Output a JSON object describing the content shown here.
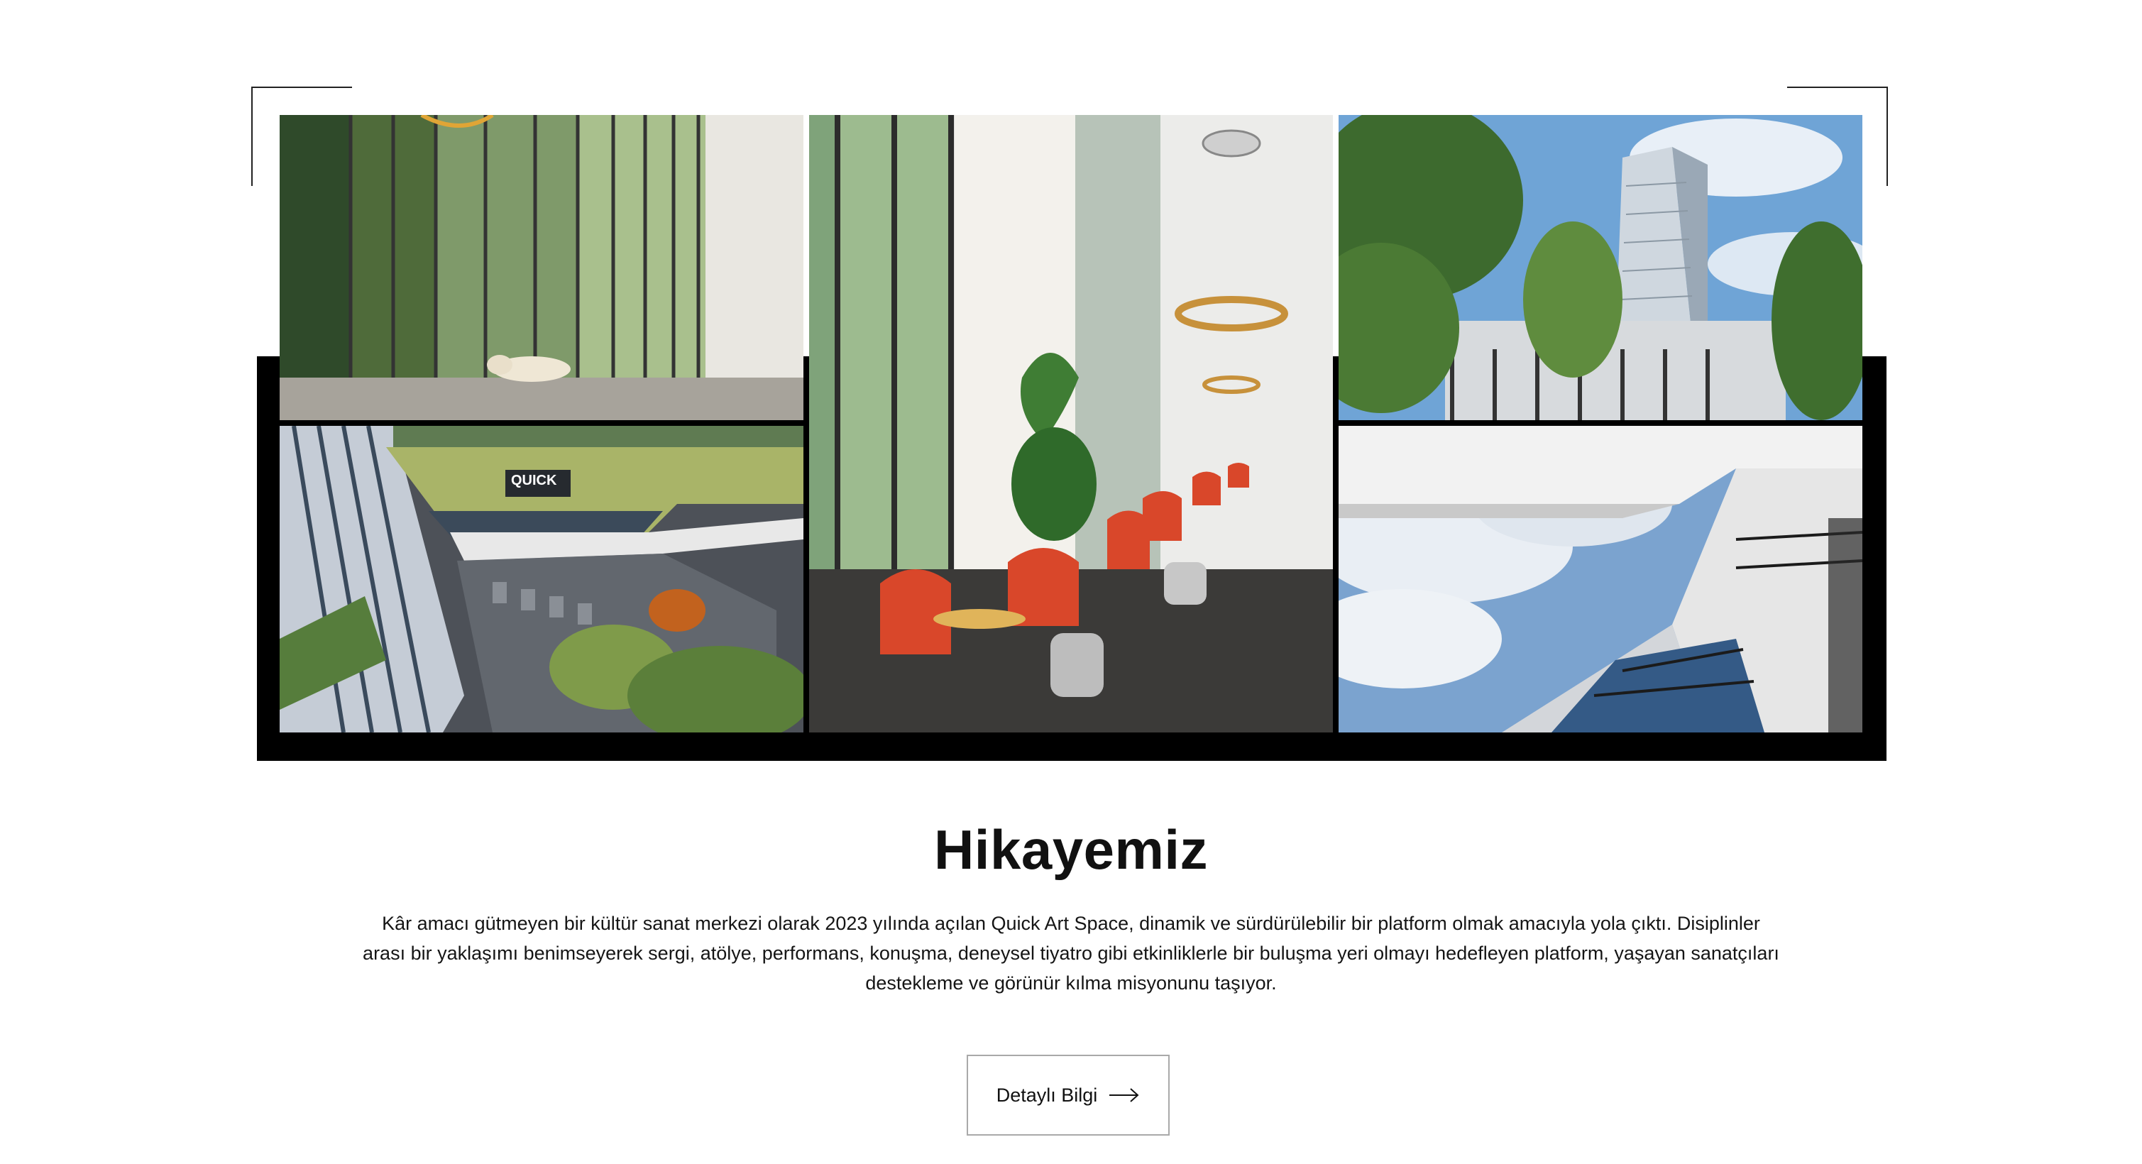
{
  "gallery": {
    "tiles": [
      {
        "name": "tower-facade-dog"
      },
      {
        "name": "lounge-red-chairs"
      },
      {
        "name": "tower-exterior-sky"
      },
      {
        "name": "campus-aerial-view",
        "sign_text": "QUICK"
      },
      {
        "name": "looking-up-towers"
      }
    ]
  },
  "story": {
    "title": "Hikayemiz",
    "body": "Kâr amacı gütmeyen bir kültür sanat merkezi olarak 2023 yılında açılan Quick Art Space, dinamik ve sürdürülebilir bir platform olmak amacıyla yola çıktı. Disiplinler arası bir yaklaşımı benimseyerek sergi, atölye, performans, konuşma, deneysel tiyatro gibi etkinliklerle bir buluşma yeri olmayı hedefleyen platform, yaşayan sanatçıları destekleme ve görünür kılma misyonunu taşıyor.",
    "cta_label": "Detaylı Bilgi",
    "cta_icon": "arrow-right-icon"
  },
  "colors": {
    "frame": "#000000",
    "accent_chair": "#d9472a",
    "text": "#111111"
  }
}
